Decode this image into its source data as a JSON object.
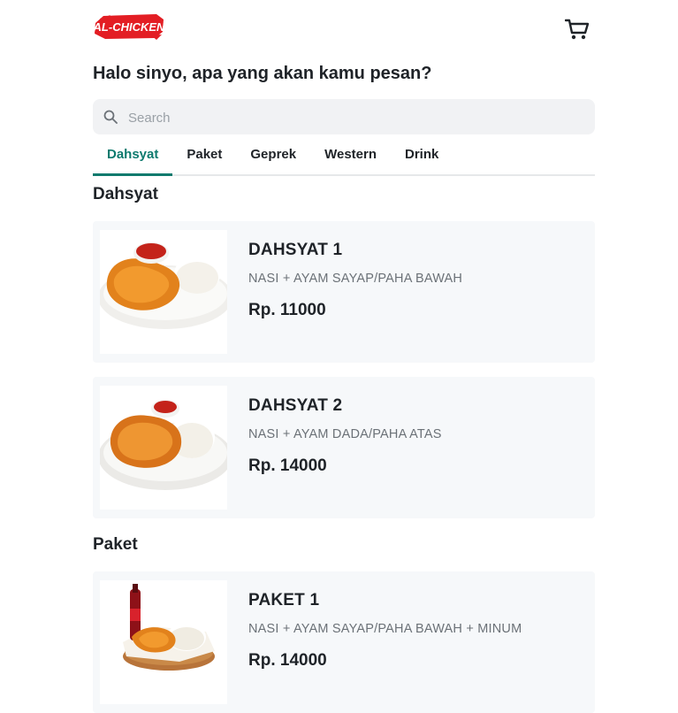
{
  "brand": {
    "logo_text": "AL-CHICKEN",
    "accent": "#e31e24"
  },
  "header": {
    "cart_icon": "cart-icon"
  },
  "greeting": "Halo sinyo, apa yang akan kamu pesan?",
  "search": {
    "placeholder": "Search",
    "value": ""
  },
  "tabs": [
    {
      "label": "Dahsyat",
      "active": true
    },
    {
      "label": "Paket",
      "active": false
    },
    {
      "label": "Geprek",
      "active": false
    },
    {
      "label": "Western",
      "active": false
    },
    {
      "label": "Drink",
      "active": false
    }
  ],
  "accent_color": "#0e7a6e",
  "sections": [
    {
      "title": "Dahsyat",
      "items": [
        {
          "name": "DAHSYAT 1",
          "desc": "NASI + AYAM SAYAP/PAHA BAWAH",
          "price": "Rp. 11000"
        },
        {
          "name": "DAHSYAT 2",
          "desc": "NASI + AYAM DADA/PAHA ATAS",
          "price": "Rp. 14000"
        }
      ]
    },
    {
      "title": "Paket",
      "items": [
        {
          "name": "PAKET 1",
          "desc": "NASI + AYAM SAYAP/PAHA BAWAH + MINUM",
          "price": "Rp. 14000"
        }
      ]
    }
  ]
}
